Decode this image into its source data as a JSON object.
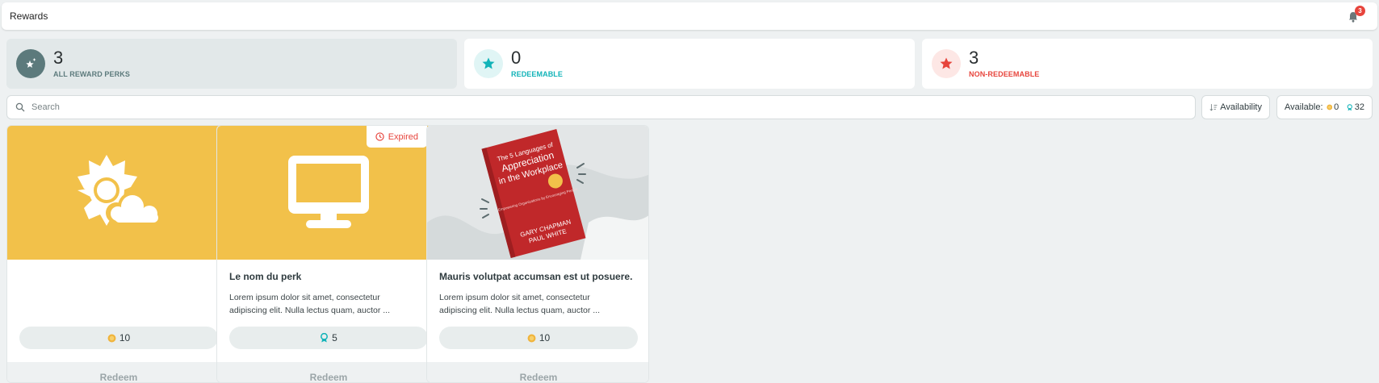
{
  "header": {
    "title": "Rewards",
    "notification_count": "3"
  },
  "stats": [
    {
      "value": "3",
      "label": "ALL REWARD PERKS",
      "color": "#5c7a7c",
      "icon": "sparkle-star-icon"
    },
    {
      "value": "0",
      "label": "REDEEMABLE",
      "color": "#12b3b8",
      "icon": "star-icon"
    },
    {
      "value": "3",
      "label": "NON-REDEEMABLE",
      "color": "#e7443c",
      "icon": "star-icon"
    }
  ],
  "search": {
    "placeholder": "Search",
    "value": ""
  },
  "sort": {
    "label": "Availability"
  },
  "available": {
    "label": "Available:",
    "coins": "0",
    "badges": "32"
  },
  "cards": [
    {
      "title": "",
      "description": "",
      "cost": "10",
      "cost_type": "coin",
      "redeem_label": "Redeem",
      "media": "weather-icon",
      "media_bg": "#f2c14a"
    },
    {
      "title": "Le nom du perk",
      "description": "Lorem ipsum dolor sit amet, consectetur adipiscing elit. Nulla lectus quam, auctor ...",
      "cost": "5",
      "cost_type": "badge",
      "redeem_label": "Redeem",
      "badge": "Expired",
      "media": "monitor-icon",
      "media_bg": "#f2c14a"
    },
    {
      "title": "Mauris volutpat accumsan est ut posuere.",
      "description": "Lorem ipsum dolor sit amet, consectetur adipiscing elit. Nulla lectus quam, auctor ...",
      "cost": "10",
      "cost_type": "coin",
      "redeem_label": "Redeem",
      "media": "book-cover-image",
      "media_bg": "#e3e6e7",
      "book": {
        "top": "The 5 Languages of",
        "title_1": "Appreciation",
        "title_2": "in the Workplace",
        "subtitle": "Empowering Organizations by Encouraging People",
        "author_1": "GARY CHAPMAN",
        "author_2": "PAUL WHITE"
      }
    }
  ]
}
